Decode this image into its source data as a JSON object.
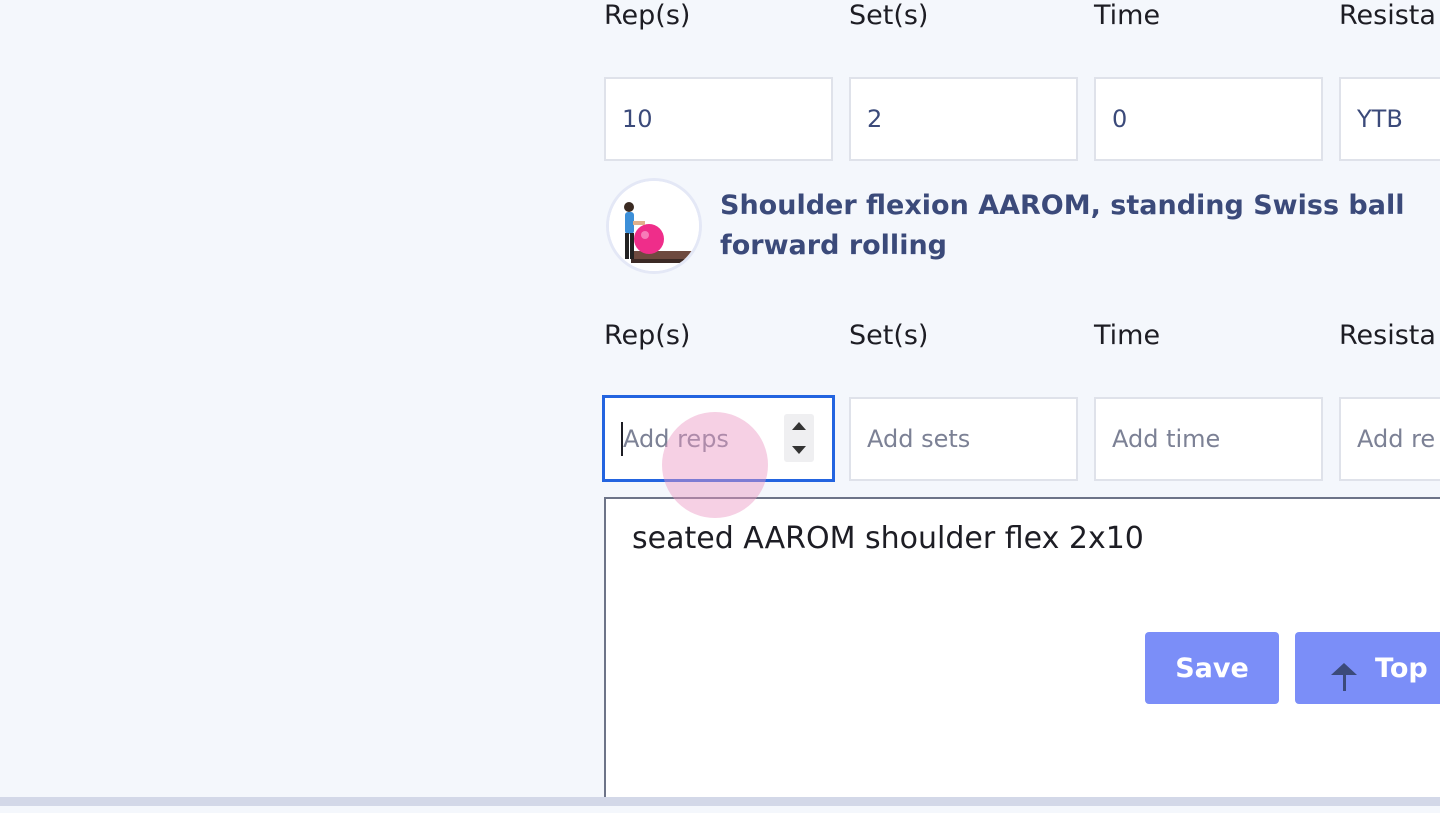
{
  "row1": {
    "labels": {
      "reps": "Rep(s)",
      "sets": "Set(s)",
      "time": "Time",
      "resistance": "Resista"
    },
    "values": {
      "reps": "10",
      "sets": "2",
      "time": "0",
      "resistance": "YTB"
    }
  },
  "exercise": {
    "title": "Shoulder flexion AAROM, standing Swiss ball forward rolling",
    "thumbnail_icon": "exercise-photo-thumbnail"
  },
  "row2": {
    "labels": {
      "reps": "Rep(s)",
      "sets": "Set(s)",
      "time": "Time",
      "resistance": "Resista"
    },
    "placeholders": {
      "reps": "Add reps",
      "sets": "Add sets",
      "time": "Add time",
      "resistance": "Add re"
    }
  },
  "notes": {
    "text": "seated AAROM shoulder flex 2x10"
  },
  "buttons": {
    "save": "Save",
    "top": "Top"
  },
  "colors": {
    "background": "#f4f7fc",
    "accent_button": "#7b8ef8",
    "focus_border": "#2364e0",
    "title_text": "#3b4a7a"
  }
}
